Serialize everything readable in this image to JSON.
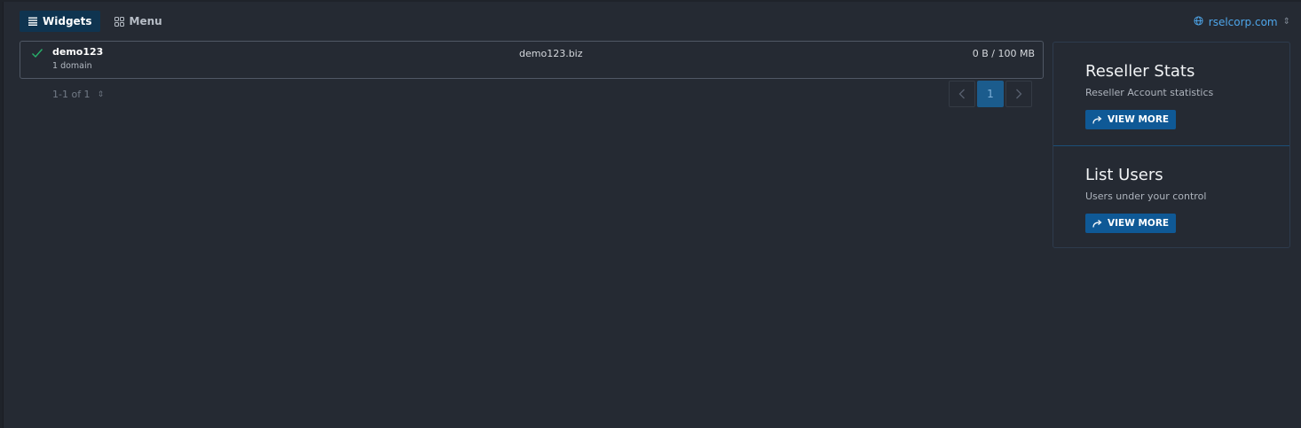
{
  "tabs": [
    {
      "label": "Widgets",
      "icon": "list-icon",
      "active": true
    },
    {
      "label": "Menu",
      "icon": "grid-icon",
      "active": false
    }
  ],
  "domain_selector": {
    "icon": "globe-icon",
    "value": "rselcorp.com"
  },
  "account": {
    "name": "demo123",
    "subtitle": "1 domain",
    "domain": "demo123.biz",
    "usage": "0 B / 100 MB",
    "status_icon": "check-icon"
  },
  "pagination": {
    "count_label": "1-1 of 1",
    "current_page": "1"
  },
  "side_panel": {
    "sections": [
      {
        "title": "Reseller Stats",
        "description": "Reseller Account statistics",
        "button_label": "VIEW MORE"
      },
      {
        "title": "List Users",
        "description": "Users under your control",
        "button_label": "VIEW MORE"
      }
    ]
  },
  "colors": {
    "background": "#252a33",
    "accent": "#0f5996",
    "link": "#4ea6ea",
    "check": "#27b06a"
  }
}
